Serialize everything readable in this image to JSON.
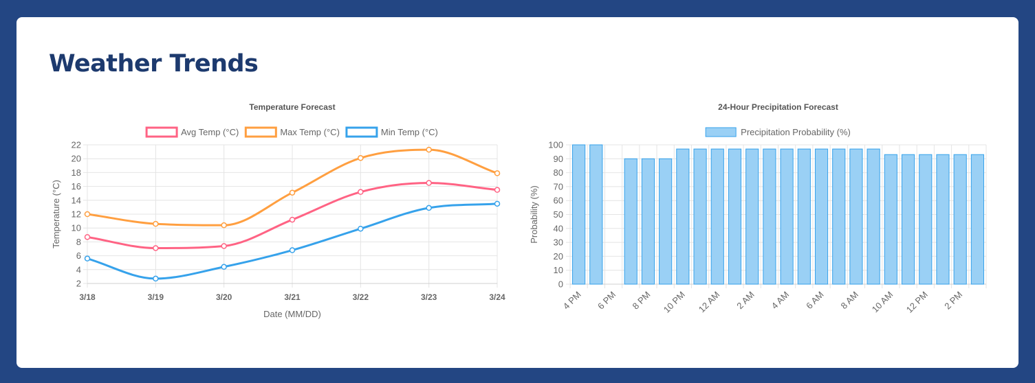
{
  "page": {
    "title": "Weather Trends"
  },
  "charts": {
    "temperature": {
      "type": "line",
      "title": "Temperature Forecast",
      "xlabel": "Date (MM/DD)",
      "ylabel": "Temperature (°C)",
      "categories": [
        "3/18",
        "3/19",
        "3/20",
        "3/21",
        "3/22",
        "3/23",
        "3/24"
      ],
      "ylim": [
        2,
        22
      ],
      "yticks": [
        2,
        4,
        6,
        8,
        10,
        12,
        14,
        16,
        18,
        20,
        22
      ],
      "grid": true,
      "legend_position": "top",
      "series": [
        {
          "name": "Avg Temp (°C)",
          "color": "#ff6384",
          "values": [
            8.7,
            7.1,
            7.4,
            11.2,
            15.2,
            16.5,
            15.5
          ]
        },
        {
          "name": "Max Temp (°C)",
          "color": "#ff9f40",
          "values": [
            12.0,
            10.6,
            10.4,
            15.1,
            20.1,
            21.3,
            17.9
          ]
        },
        {
          "name": "Min Temp (°C)",
          "color": "#36a2eb",
          "values": [
            5.6,
            2.7,
            4.4,
            6.8,
            9.9,
            12.9,
            13.5
          ]
        }
      ]
    },
    "precipitation": {
      "type": "bar",
      "title": "24-Hour Precipitation Forecast",
      "xlabel": "",
      "ylabel": "Probability (%)",
      "ylim": [
        0,
        100
      ],
      "yticks": [
        0,
        10,
        20,
        30,
        40,
        50,
        60,
        70,
        80,
        90,
        100
      ],
      "grid": true,
      "legend_position": "top",
      "series": [
        {
          "name": "Precipitation Probability (%)",
          "fill_color": "#9ad0f5",
          "border_color": "#36a2eb",
          "values": [
            100,
            100,
            0,
            90,
            90,
            90,
            97,
            97,
            97,
            97,
            97,
            97,
            97,
            97,
            97,
            97,
            97,
            97,
            93,
            93,
            93,
            93,
            93,
            93
          ]
        }
      ],
      "visible_tick_labels": [
        "4 PM",
        "6 PM",
        "8 PM",
        "10 PM",
        "12 AM",
        "2 AM",
        "4 AM",
        "6 AM",
        "8 AM",
        "10 AM",
        "12 PM",
        "2 PM"
      ]
    }
  }
}
